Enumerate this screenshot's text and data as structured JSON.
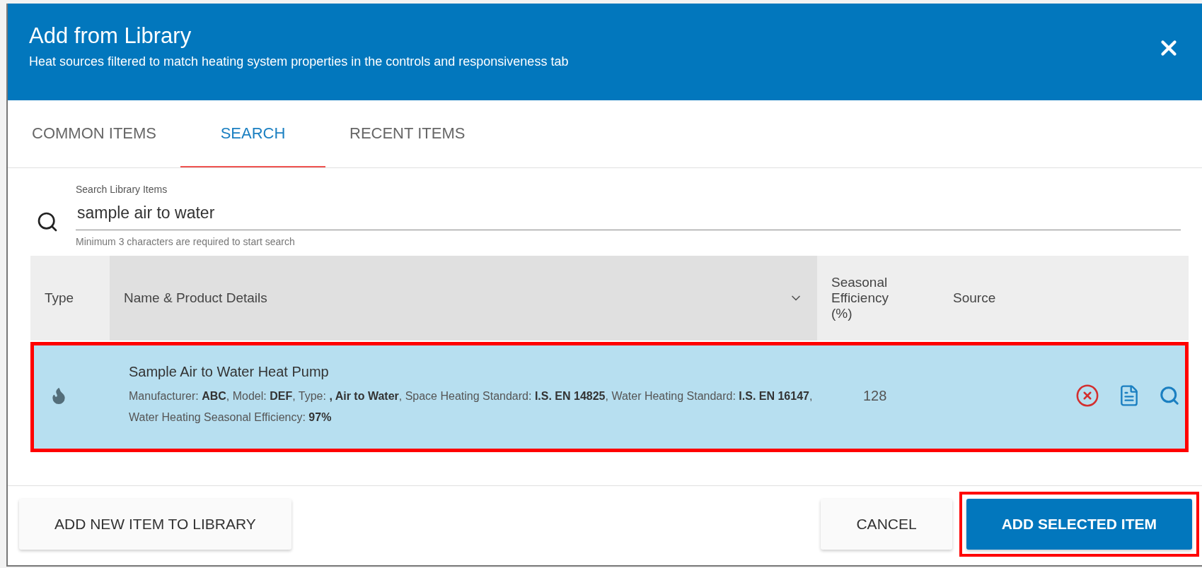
{
  "dialog": {
    "title": "Add from Library",
    "subtitle": "Heat sources filtered to match heating system properties in the controls and responsiveness tab"
  },
  "tabs": [
    {
      "label": "COMMON ITEMS",
      "selected": false
    },
    {
      "label": "SEARCH",
      "selected": true
    },
    {
      "label": "RECENT ITEMS",
      "selected": false
    }
  ],
  "search": {
    "label": "Search Library Items",
    "value": "sample air to water",
    "hint": "Minimum 3 characters are required to start search"
  },
  "table": {
    "columns": [
      {
        "label": "Type",
        "sorted": false
      },
      {
        "label": "Name & Product Details",
        "sorted": true
      },
      {
        "label": "Seasonal Efficiency (%)",
        "sorted": false
      },
      {
        "label": "Source",
        "sorted": false
      }
    ],
    "rows": [
      {
        "name": "Sample Air to Water Heat Pump",
        "details": "Manufacturer: **ABC**, Model: **DEF**, Type: **, Air to Water**, Space Heating Standard: **I.S. EN 14825**, Water Heating Standard: **I.S. EN 16147**, Water Heating Seasonal Efficiency: **97%**",
        "efficiency": "128",
        "selected": true,
        "highlighted": true
      }
    ]
  },
  "footer": {
    "buttons": [
      {
        "label": "ADD NEW ITEM TO LIBRARY",
        "kind": "secondary",
        "highlighted": false
      },
      {
        "label": "CANCEL",
        "kind": "secondary",
        "highlighted": false
      },
      {
        "label": "ADD SELECTED ITEM",
        "kind": "primary",
        "highlighted": true
      }
    ]
  }
}
